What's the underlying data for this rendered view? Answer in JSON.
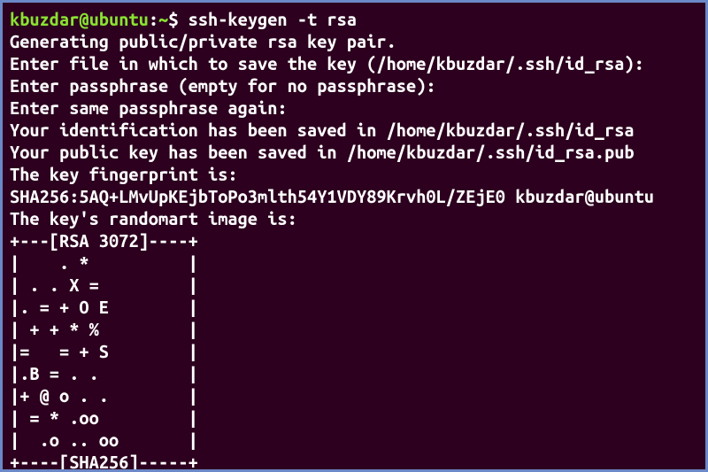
{
  "prompt": {
    "user_host": "kbuzdar@ubuntu",
    "sep": ":",
    "path": "~",
    "dollar": "$ ",
    "command": "ssh-keygen -t rsa"
  },
  "output": {
    "l1": "Generating public/private rsa key pair.",
    "l2": "Enter file in which to save the key (/home/kbuzdar/.ssh/id_rsa):",
    "l3": "Enter passphrase (empty for no passphrase):",
    "l4": "Enter same passphrase again:",
    "l5": "Your identification has been saved in /home/kbuzdar/.ssh/id_rsa",
    "l6": "Your public key has been saved in /home/kbuzdar/.ssh/id_rsa.pub",
    "l7": "The key fingerprint is:",
    "l8": "SHA256:5AQ+LMvUpKEjbToPo3mlth54Y1VDY89Krvh0L/ZEjE0 kbuzdar@ubuntu",
    "l9": "The key's randomart image is:",
    "r1": "+---[RSA 3072]----+",
    "r2": "|    . *          |",
    "r3": "| . . X =         |",
    "r4": "|. = + O E        |",
    "r5": "| + + * %         |",
    "r6": "|=   = + S        |",
    "r7": "|.B = . .         |",
    "r8": "|+ @ o . .        |",
    "r9": "| = * .oo         |",
    "r10": "|  .o .. oo       |",
    "r11": "+----[SHA256]-----+"
  }
}
